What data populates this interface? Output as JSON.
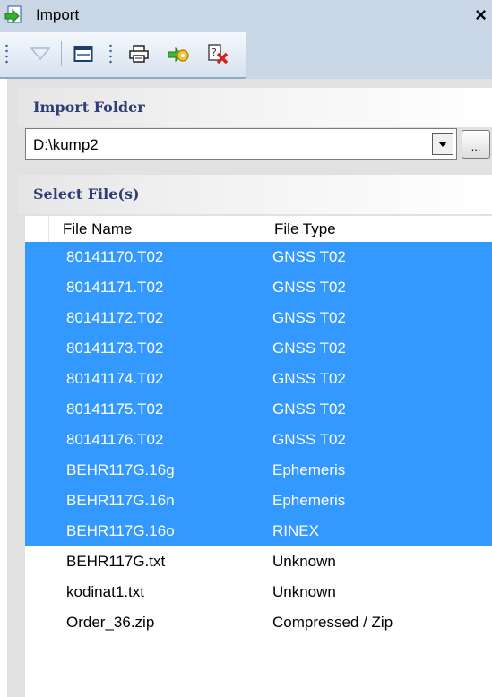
{
  "window": {
    "title": "Import",
    "close_glyph": "×",
    "title_icon": "import-arrow-icon"
  },
  "toolbar": {
    "buttons": [
      {
        "name": "dropdown-icon",
        "enabled": false
      },
      {
        "name": "window-icon",
        "enabled": true
      },
      {
        "name": "print-preview-icon",
        "enabled": true
      },
      {
        "name": "import-settings-icon",
        "enabled": true
      },
      {
        "name": "delete-icon",
        "enabled": true
      }
    ]
  },
  "import_folder": {
    "heading": "Import Folder",
    "path": "D:\\kump2",
    "browse_label": "..."
  },
  "select_files": {
    "heading": "Select File(s)",
    "columns": [
      "File Name",
      "File Type"
    ],
    "rows": [
      {
        "name": "80141170.T02",
        "type": "GNSS T02",
        "selected": true
      },
      {
        "name": "80141171.T02",
        "type": "GNSS T02",
        "selected": true
      },
      {
        "name": "80141172.T02",
        "type": "GNSS T02",
        "selected": true
      },
      {
        "name": "80141173.T02",
        "type": "GNSS T02",
        "selected": true
      },
      {
        "name": "80141174.T02",
        "type": "GNSS T02",
        "selected": true
      },
      {
        "name": "80141175.T02",
        "type": "GNSS T02",
        "selected": true
      },
      {
        "name": "80141176.T02",
        "type": "GNSS T02",
        "selected": true
      },
      {
        "name": "BEHR117G.16g",
        "type": "Ephemeris",
        "selected": true
      },
      {
        "name": "BEHR117G.16n",
        "type": "Ephemeris",
        "selected": true
      },
      {
        "name": "BEHR117G.16o",
        "type": "RINEX",
        "selected": true
      },
      {
        "name": "BEHR117G.txt",
        "type": "Unknown",
        "selected": false
      },
      {
        "name": "kodinat1.txt",
        "type": "Unknown",
        "selected": false
      },
      {
        "name": "Order_36.zip",
        "type": "Compressed / Zip",
        "selected": false
      }
    ]
  },
  "colors": {
    "selection": "#3399ff",
    "heading_text": "#2e3f77",
    "toolbar_bg": "#c9d6e6"
  }
}
